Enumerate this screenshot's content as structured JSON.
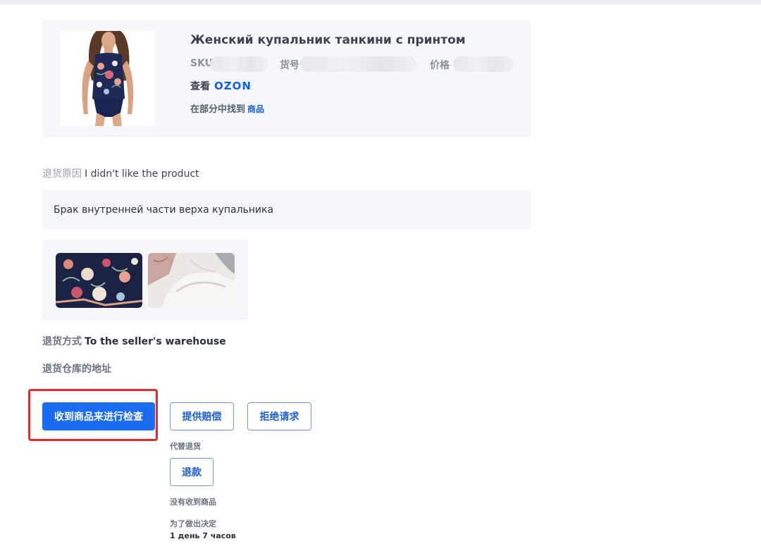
{
  "product": {
    "title": "Женский купальник танкини с принтом",
    "sku_label": "SKU",
    "article_label": "货号",
    "price_label": "价格",
    "view_label": "查看",
    "marketplace_logo": "OZON",
    "found_in_label": "在部分中找到",
    "found_in_link": "商品"
  },
  "return_reason": {
    "label": "退货原因",
    "value": "I didn't like the product"
  },
  "customer_comment": "Брак внутренней части верха купальника",
  "return_method": {
    "label": "退货方式",
    "value": "To the seller's warehouse"
  },
  "warehouse_address_label": "退货仓库的地址",
  "actions": {
    "receive_for_inspection": "收到商品来进行检查",
    "offer_compensation": "提供赔偿",
    "reject_request": "拒绝请求",
    "instead_of_return_label": "代替退货",
    "refund": "退款",
    "not_received_label": "没有收到商品",
    "decision_time_label": "为了做出决定",
    "decision_time_value": "1 день 7 часов"
  },
  "colors": {
    "primary": "#1b6cf2",
    "highlight_frame": "#e52b2b",
    "link": "#1a5fd6",
    "card_bg": "#f5f7fa"
  },
  "icons": [
    "ozon-logo"
  ]
}
